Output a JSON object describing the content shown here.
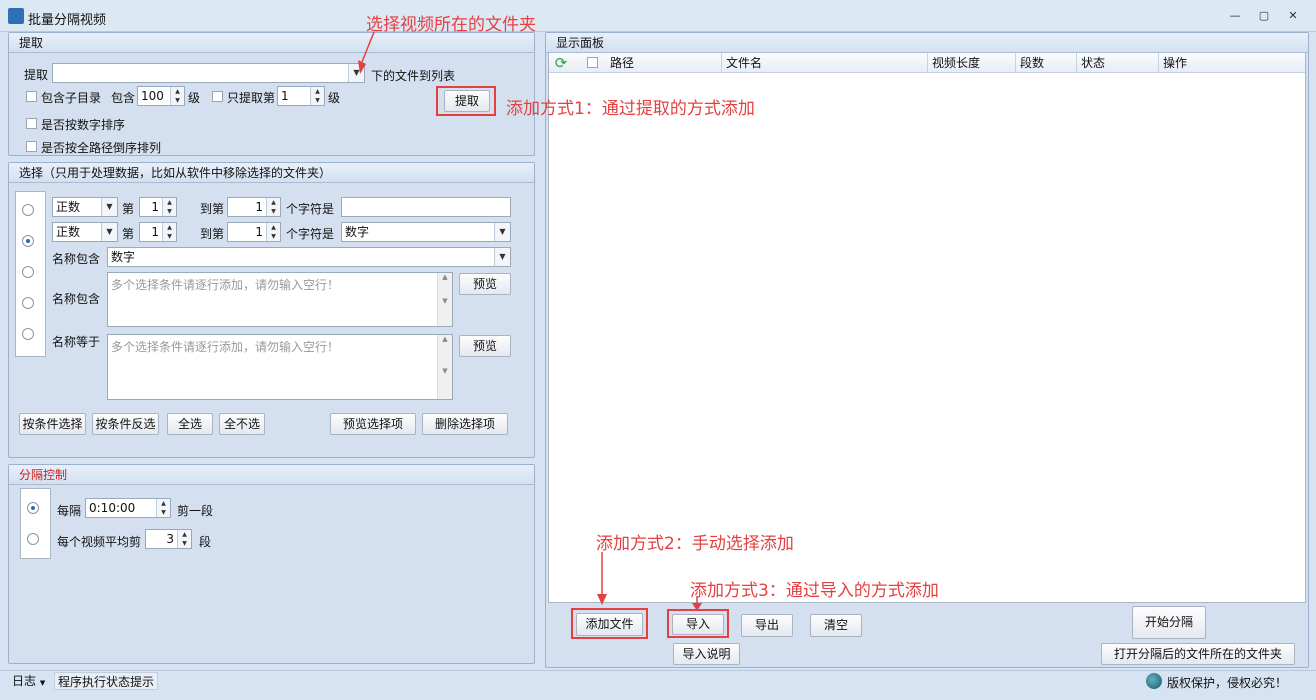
{
  "window": {
    "title": "批量分隔视频",
    "min": "—",
    "restore": "▢",
    "close": "✕"
  },
  "extract": {
    "header": "提取",
    "label": "提取",
    "path_value": "",
    "suffix": "下的文件到列表",
    "include_subdir": "包含子目录",
    "include": "包含",
    "levels": "100",
    "level_unit": "级",
    "only_extract": "只提取第",
    "only_level": "1",
    "level_unit2": "级",
    "numeric_sort": "是否按数字排序",
    "reverse_sort": "是否按全路径倒序排列",
    "button": "提取"
  },
  "select": {
    "header": "选择（只用于处理数据，比如从软件中移除选择的文件夹）",
    "row1": {
      "type": "正数",
      "di": "第",
      "from": "1",
      "dao": "到第",
      "to": "1",
      "chars": "个字符是",
      "value": ""
    },
    "row2": {
      "type": "正数",
      "di": "第",
      "from": "1",
      "dao": "到第",
      "to": "1",
      "chars": "个字符是",
      "value": "数字"
    },
    "row3": {
      "label": "名称包含",
      "value": "数字"
    },
    "row4": {
      "label": "名称包含",
      "placeholder": "多个选择条件请逐行添加，请勿输入空行！",
      "preview": "预览"
    },
    "row5": {
      "label": "名称等于",
      "placeholder": "多个选择条件请逐行添加，请勿输入空行！",
      "preview": "预览"
    },
    "buttons": {
      "by_cond": "按条件选择",
      "by_cond_inv": "按条件反选",
      "all": "全选",
      "none": "全不选",
      "preview_sel": "预览选择项",
      "delete_sel": "删除选择项"
    }
  },
  "split": {
    "header": "分隔控制",
    "every": "每隔",
    "interval": "0:10:00",
    "cut_one": "剪一段",
    "avg": "每个视频平均剪",
    "segments": "3",
    "seg_unit": "段"
  },
  "display": {
    "header": "显示面板",
    "columns": [
      "路径",
      "文件名",
      "视频长度",
      "段数",
      "状态",
      "操作"
    ]
  },
  "actions": {
    "add_file": "添加文件",
    "import": "导入",
    "export": "导出",
    "clear": "清空",
    "import_help": "导入说明",
    "start": "开始分隔",
    "open_folder": "打开分隔后的文件所在的文件夹"
  },
  "annotations": {
    "a0": "选择视频所在的文件夹",
    "a1": "添加方式1：通过提取的方式添加",
    "a2": "添加方式2：手动选择添加",
    "a3": "添加方式3：通过导入的方式添加"
  },
  "status": {
    "log": "日志",
    "hint": "程序执行状态提示",
    "copyright": "版权保护，侵权必究！"
  },
  "colors": {
    "accent": "#e54040",
    "panel": "#d4e0ef"
  }
}
